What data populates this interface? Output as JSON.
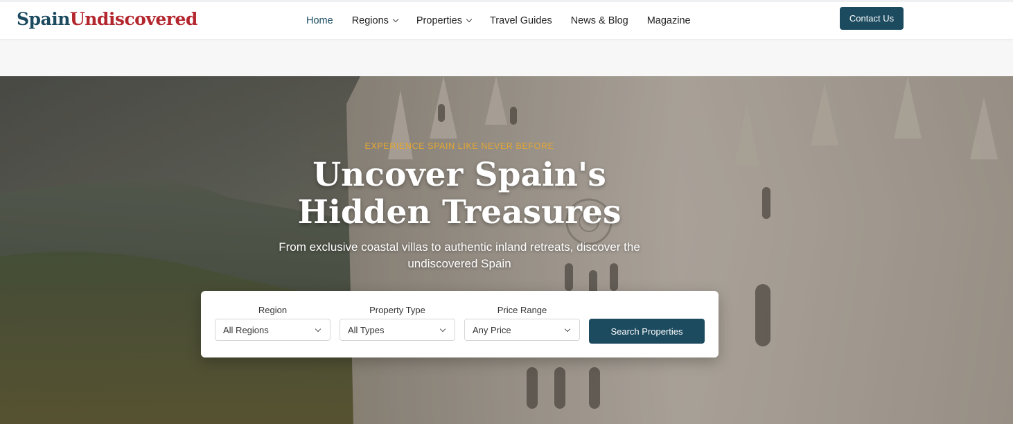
{
  "logo": {
    "part1": "Spain",
    "part2": "Undiscovered"
  },
  "nav": {
    "items": [
      {
        "label": "Home",
        "dropdown": false,
        "active": true
      },
      {
        "label": "Regions",
        "dropdown": true
      },
      {
        "label": "Properties",
        "dropdown": true
      },
      {
        "label": "Travel Guides",
        "dropdown": false
      },
      {
        "label": "News & Blog",
        "dropdown": false
      },
      {
        "label": "Magazine",
        "dropdown": false
      }
    ],
    "contact_label": "Contact Us"
  },
  "hero": {
    "eyebrow": "EXPERIENCE SPAIN LIKE NEVER BEFORE",
    "headline": "Uncover Spain's Hidden Treasures",
    "subline": "From exclusive coastal villas to authentic inland retreats, discover the undiscovered Spain"
  },
  "search": {
    "region": {
      "label": "Region",
      "value": "All Regions"
    },
    "type": {
      "label": "Property Type",
      "value": "All Types"
    },
    "price": {
      "label": "Price Range",
      "value": "Any Price"
    },
    "button_label": "Search Properties"
  },
  "colors": {
    "brand_dark": "#1c4a5f",
    "brand_red": "#b3262d",
    "accent_gold": "#e3a731"
  }
}
